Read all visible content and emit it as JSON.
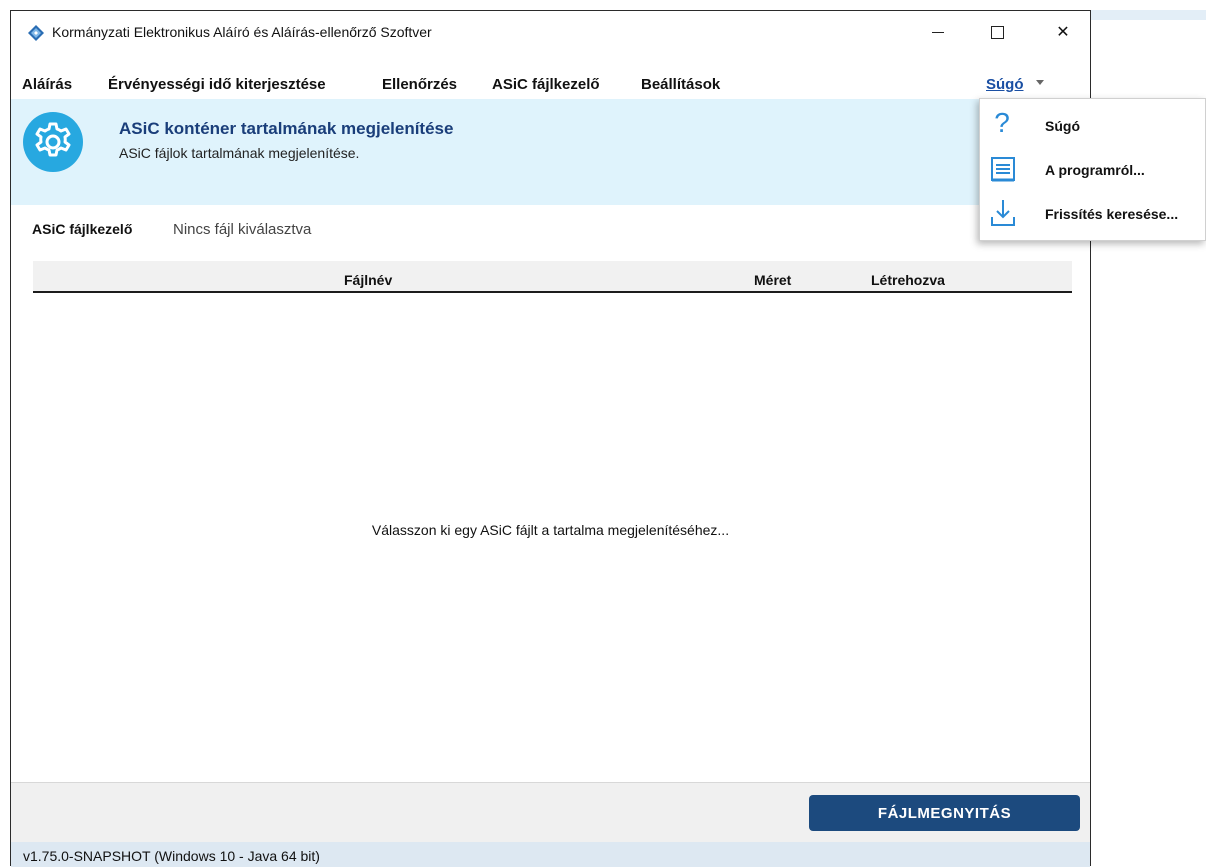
{
  "window": {
    "title": "Kormányzati Elektronikus Aláíró és Aláírás-ellenőrző Szoftver",
    "controls": {
      "minimize_icon": "minimize-icon",
      "maximize_icon": "maximize-icon",
      "close_icon": "close-icon",
      "close_glyph": "✕"
    }
  },
  "menubar": {
    "items": [
      {
        "label": "Aláírás"
      },
      {
        "label": "Érvényességi idő kiterjesztése"
      },
      {
        "label": "Ellenőrzés"
      },
      {
        "label": "ASiC fájlkezelő"
      },
      {
        "label": "Beállítások"
      }
    ],
    "help": {
      "label": "Súgó"
    }
  },
  "banner": {
    "icon": "gear-icon",
    "title": "ASiC konténer tartalmának megjelenítése",
    "subtitle": "ASiC fájlok tartalmának megjelenítése.",
    "background": "#dff3fc",
    "title_color": "#1a3e7a"
  },
  "file_selector": {
    "label": "ASiC fájlkezelő",
    "status": "Nincs fájl kiválasztva"
  },
  "table": {
    "columns": [
      "Fájlnév",
      "Méret",
      "Létrehozva"
    ],
    "rows": [],
    "empty_message": "Válasszon ki egy ASiC fájlt a tartalma megjelenítéséhez..."
  },
  "actions": {
    "open_file": "FÁJLMEGNYITÁS",
    "button_color": "#1c4a7e"
  },
  "status_bar": {
    "version": "v1.75.0-SNAPSHOT (Windows 10 - Java 64 bit)"
  },
  "help_dropdown": {
    "items": [
      {
        "label": "Súgó",
        "icon": "question-icon",
        "glyph": "?"
      },
      {
        "label": "A programról...",
        "icon": "document-icon"
      },
      {
        "label": "Frissítés keresése...",
        "icon": "download-icon"
      }
    ]
  }
}
